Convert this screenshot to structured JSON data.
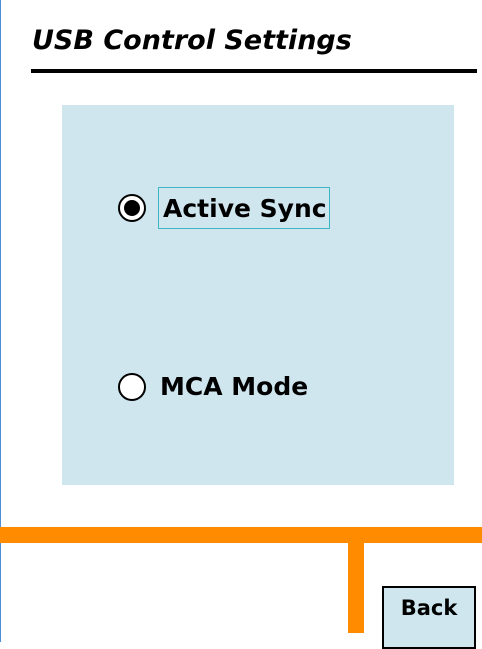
{
  "header": {
    "title": "USB Control Settings"
  },
  "usb_mode": {
    "options": [
      {
        "label": "Active Sync",
        "selected": true
      },
      {
        "label": "MCA Mode",
        "selected": false
      }
    ]
  },
  "footer": {
    "back_label": "Back"
  },
  "colors": {
    "panel_background": "#cfe6ee",
    "accent_orange": "#ff8c00",
    "focus_outline": "#3cb6c7",
    "title_rule": "#000000"
  }
}
